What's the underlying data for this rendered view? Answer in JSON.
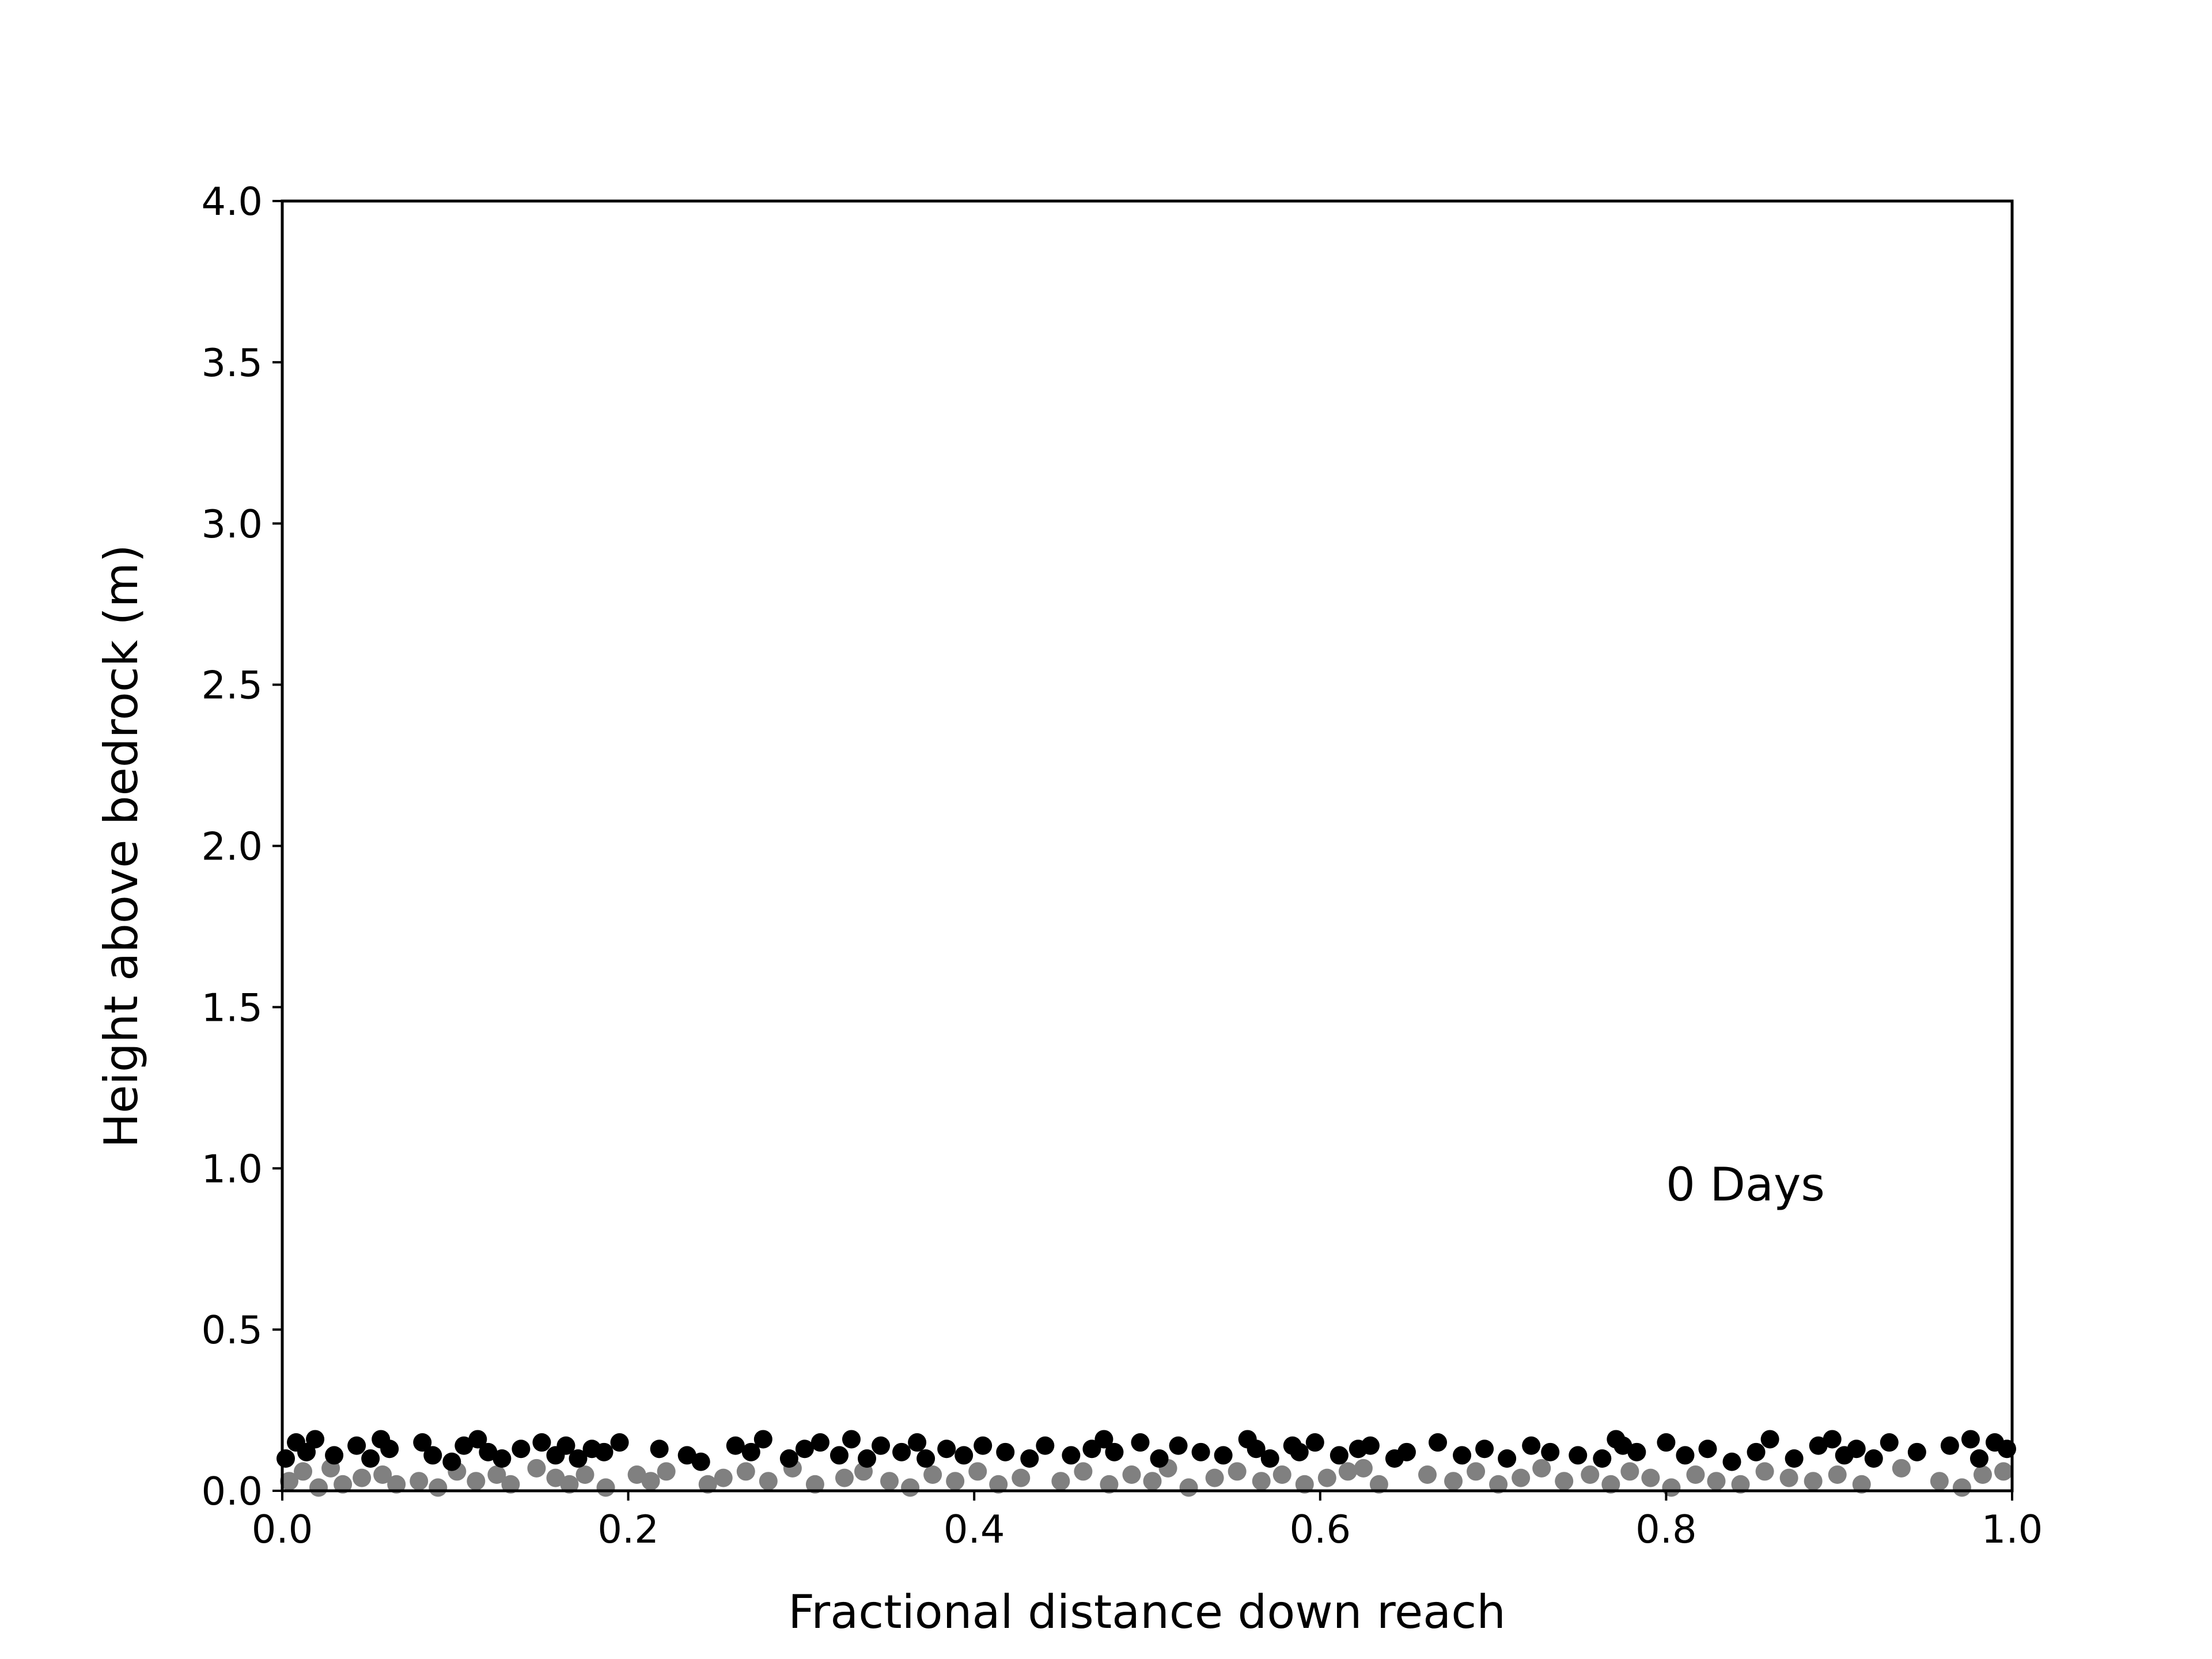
{
  "chart_data": {
    "type": "scatter",
    "title": "",
    "xlabel": "Fractional distance down reach",
    "ylabel": "Height above bedrock (m)",
    "xlim": [
      0.0,
      1.0
    ],
    "ylim": [
      0.0,
      4.0
    ],
    "xticks": [
      0.0,
      0.2,
      0.4,
      0.6,
      0.8,
      1.0
    ],
    "xtick_labels": [
      "0.0",
      "0.2",
      "0.4",
      "0.6",
      "0.8",
      "1.0"
    ],
    "yticks": [
      0.0,
      0.5,
      1.0,
      1.5,
      2.0,
      2.5,
      3.0,
      3.5,
      4.0
    ],
    "ytick_labels": [
      "0.0",
      "0.5",
      "1.0",
      "1.5",
      "2.0",
      "2.5",
      "3.0",
      "3.5",
      "4.0"
    ],
    "grid": false,
    "annotations": [
      {
        "text": "0 Days",
        "x": 0.8,
        "y": 0.95
      }
    ],
    "series": [
      {
        "color": "#808080",
        "x": [
          0.004,
          0.012,
          0.021,
          0.028,
          0.035,
          0.046,
          0.058,
          0.066,
          0.079,
          0.09,
          0.101,
          0.112,
          0.124,
          0.132,
          0.147,
          0.158,
          0.166,
          0.175,
          0.187,
          0.205,
          0.213,
          0.222,
          0.246,
          0.255,
          0.268,
          0.281,
          0.295,
          0.308,
          0.325,
          0.336,
          0.351,
          0.363,
          0.376,
          0.389,
          0.402,
          0.414,
          0.427,
          0.45,
          0.463,
          0.478,
          0.491,
          0.503,
          0.512,
          0.524,
          0.539,
          0.552,
          0.566,
          0.578,
          0.591,
          0.604,
          0.616,
          0.625,
          0.634,
          0.662,
          0.677,
          0.69,
          0.703,
          0.716,
          0.728,
          0.741,
          0.756,
          0.768,
          0.779,
          0.791,
          0.803,
          0.817,
          0.829,
          0.843,
          0.857,
          0.871,
          0.885,
          0.899,
          0.913,
          0.936,
          0.958,
          0.971,
          0.983,
          0.995
        ],
        "y": [
          0.03,
          0.06,
          0.01,
          0.07,
          0.02,
          0.04,
          0.05,
          0.02,
          0.03,
          0.01,
          0.06,
          0.03,
          0.05,
          0.02,
          0.07,
          0.04,
          0.02,
          0.05,
          0.01,
          0.05,
          0.03,
          0.06,
          0.02,
          0.04,
          0.06,
          0.03,
          0.07,
          0.02,
          0.04,
          0.06,
          0.03,
          0.01,
          0.05,
          0.03,
          0.06,
          0.02,
          0.04,
          0.03,
          0.06,
          0.02,
          0.05,
          0.03,
          0.07,
          0.01,
          0.04,
          0.06,
          0.03,
          0.05,
          0.02,
          0.04,
          0.06,
          0.07,
          0.02,
          0.05,
          0.03,
          0.06,
          0.02,
          0.04,
          0.07,
          0.03,
          0.05,
          0.02,
          0.06,
          0.04,
          0.01,
          0.05,
          0.03,
          0.02,
          0.06,
          0.04,
          0.03,
          0.05,
          0.02,
          0.07,
          0.03,
          0.01,
          0.05,
          0.06
        ]
      },
      {
        "color": "#000000",
        "x": [
          0.002,
          0.008,
          0.014,
          0.019,
          0.03,
          0.043,
          0.051,
          0.057,
          0.062,
          0.081,
          0.087,
          0.098,
          0.105,
          0.113,
          0.119,
          0.127,
          0.138,
          0.15,
          0.158,
          0.164,
          0.171,
          0.179,
          0.186,
          0.195,
          0.218,
          0.234,
          0.242,
          0.262,
          0.271,
          0.278,
          0.293,
          0.302,
          0.311,
          0.322,
          0.329,
          0.338,
          0.346,
          0.358,
          0.367,
          0.372,
          0.384,
          0.394,
          0.405,
          0.418,
          0.432,
          0.441,
          0.456,
          0.468,
          0.475,
          0.481,
          0.496,
          0.507,
          0.518,
          0.531,
          0.544,
          0.558,
          0.563,
          0.571,
          0.584,
          0.588,
          0.597,
          0.611,
          0.622,
          0.629,
          0.643,
          0.65,
          0.668,
          0.682,
          0.695,
          0.708,
          0.722,
          0.733,
          0.749,
          0.763,
          0.771,
          0.775,
          0.783,
          0.8,
          0.811,
          0.824,
          0.838,
          0.852,
          0.86,
          0.874,
          0.888,
          0.896,
          0.903,
          0.91,
          0.92,
          0.929,
          0.945,
          0.964,
          0.976,
          0.981,
          0.99,
          0.997
        ],
        "y": [
          0.1,
          0.15,
          0.12,
          0.16,
          0.11,
          0.14,
          0.1,
          0.16,
          0.13,
          0.15,
          0.11,
          0.09,
          0.14,
          0.16,
          0.12,
          0.1,
          0.13,
          0.15,
          0.11,
          0.14,
          0.1,
          0.13,
          0.12,
          0.15,
          0.13,
          0.11,
          0.09,
          0.14,
          0.12,
          0.16,
          0.1,
          0.13,
          0.15,
          0.11,
          0.16,
          0.1,
          0.14,
          0.12,
          0.15,
          0.1,
          0.13,
          0.11,
          0.14,
          0.12,
          0.1,
          0.14,
          0.11,
          0.13,
          0.16,
          0.12,
          0.15,
          0.1,
          0.14,
          0.12,
          0.11,
          0.16,
          0.13,
          0.1,
          0.14,
          0.12,
          0.15,
          0.11,
          0.13,
          0.14,
          0.1,
          0.12,
          0.15,
          0.11,
          0.13,
          0.1,
          0.14,
          0.12,
          0.11,
          0.1,
          0.16,
          0.14,
          0.12,
          0.15,
          0.11,
          0.13,
          0.09,
          0.12,
          0.16,
          0.1,
          0.14,
          0.16,
          0.11,
          0.13,
          0.1,
          0.15,
          0.12,
          0.14,
          0.16,
          0.1,
          0.15,
          0.13
        ]
      }
    ]
  }
}
